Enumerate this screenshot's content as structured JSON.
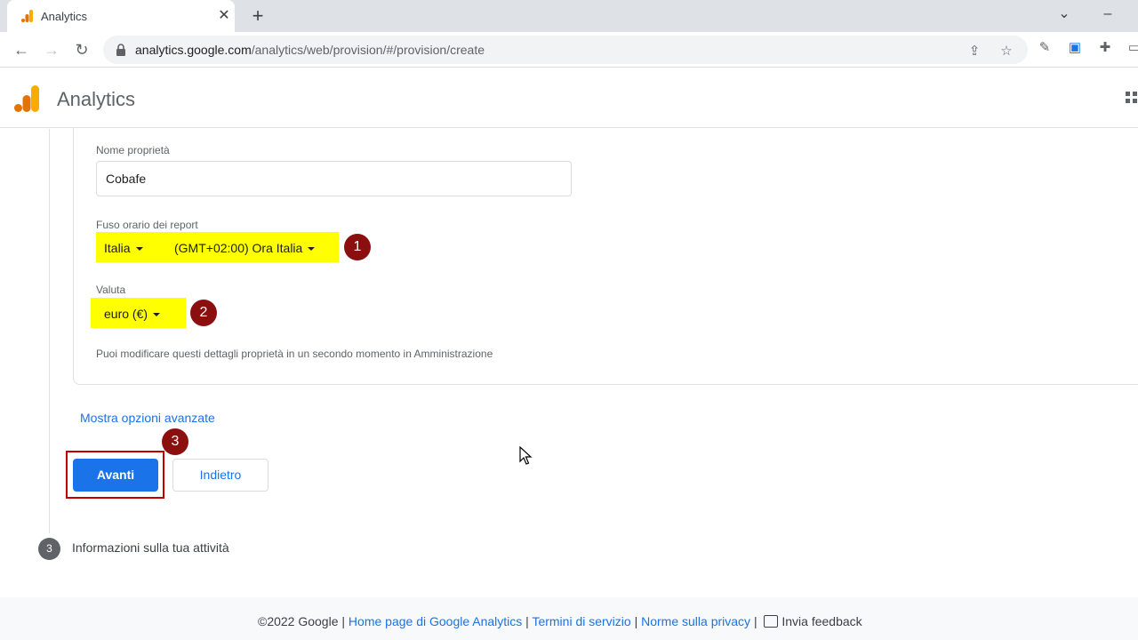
{
  "browser": {
    "tab_title": "Analytics",
    "tab_close": "✕",
    "new_tab": "+",
    "url_host": "analytics.google.com",
    "url_path": "/analytics/web/provision/#/provision/create"
  },
  "app": {
    "title": "Analytics"
  },
  "form": {
    "property_name_label": "Nome proprietà",
    "property_name_value": "Cobafe",
    "timezone_label": "Fuso orario dei report",
    "country_value": "Italia",
    "timezone_value": "(GMT+02:00) Ora Italia",
    "currency_label": "Valuta",
    "currency_value": "euro (€)",
    "note": "Puoi modificare questi dettagli proprietà in un secondo momento in Amministrazione",
    "advanced_link": "Mostra opzioni avanzate",
    "next_button": "Avanti",
    "back_button": "Indietro"
  },
  "annotations": {
    "badge1": "1",
    "badge2": "2",
    "badge3": "3",
    "highlight_color": "#ffff00",
    "badge_color": "#8b0f0f",
    "box_color": "#c00000"
  },
  "step": {
    "number": "3",
    "label": "Informazioni sulla tua attività"
  },
  "footer": {
    "copyright": "©2022 Google",
    "sep": "|",
    "home": "Home page di Google Analytics",
    "terms": "Termini di servizio",
    "privacy": "Norme sulla privacy",
    "feedback": "Invia feedback"
  },
  "colors": {
    "primary": "#1a73e8"
  }
}
